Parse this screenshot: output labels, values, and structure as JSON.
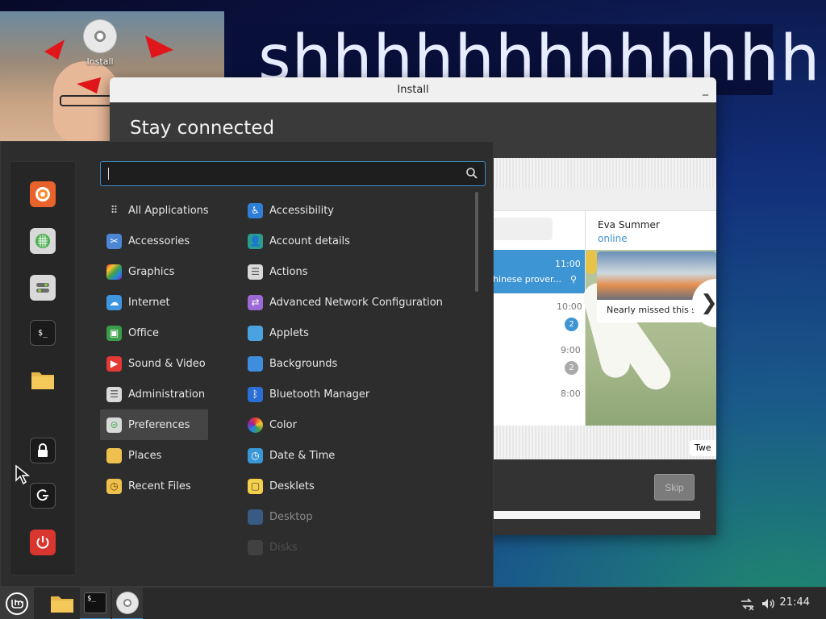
{
  "wallpaper": {
    "text": "shhhhhhhhhhhhhh"
  },
  "desktop_icons": [
    {
      "label": "Install",
      "icon": "cd-icon"
    }
  ],
  "install_window": {
    "title": "Install",
    "minimize_symbol": "_",
    "heading": "Stay connected",
    "skip_label": "Skip",
    "progress_fraction": 1.0,
    "preview": {
      "contact_name": "Eva Summer",
      "contact_status": "online",
      "chats": [
        {
          "time": "11:00",
          "preview": "hinese prover...",
          "selected": true
        },
        {
          "time": "10:00",
          "badge": "2"
        },
        {
          "time": "9:00",
          "badge": "2"
        },
        {
          "time": "8:00"
        }
      ],
      "message_caption": "Nearly missed this s",
      "message_bottom": "Twe",
      "next_symbol": "❯"
    }
  },
  "start_menu": {
    "search_value": "",
    "favorites": [
      {
        "name": "firefox-icon"
      },
      {
        "name": "software-manager-icon"
      },
      {
        "name": "system-settings-icon"
      },
      {
        "name": "terminal-icon"
      },
      {
        "name": "files-icon"
      },
      {
        "name": "lock-screen-icon"
      },
      {
        "name": "logout-icon"
      },
      {
        "name": "shutdown-icon"
      }
    ],
    "categories": [
      {
        "label": "All Applications",
        "icon": "grid-icon"
      },
      {
        "label": "Accessories",
        "icon": "scissors-icon"
      },
      {
        "label": "Graphics",
        "icon": "graphics-icon"
      },
      {
        "label": "Internet",
        "icon": "cloud-icon"
      },
      {
        "label": "Office",
        "icon": "office-icon"
      },
      {
        "label": "Sound & Video",
        "icon": "play-icon"
      },
      {
        "label": "Administration",
        "icon": "administration-icon"
      },
      {
        "label": "Preferences",
        "icon": "preferences-icon",
        "selected": true
      },
      {
        "label": "Places",
        "icon": "folder-icon"
      },
      {
        "label": "Recent Files",
        "icon": "recent-files-icon"
      }
    ],
    "apps": [
      {
        "label": "Accessibility",
        "icon": "accessibility-icon"
      },
      {
        "label": "Account details",
        "icon": "account-icon"
      },
      {
        "label": "Actions",
        "icon": "actions-icon"
      },
      {
        "label": "Advanced Network Configuration",
        "icon": "network-icon"
      },
      {
        "label": "Applets",
        "icon": "applets-icon"
      },
      {
        "label": "Backgrounds",
        "icon": "backgrounds-icon"
      },
      {
        "label": "Bluetooth Manager",
        "icon": "bluetooth-icon"
      },
      {
        "label": "Color",
        "icon": "color-icon"
      },
      {
        "label": "Date & Time",
        "icon": "clock-icon"
      },
      {
        "label": "Desklets",
        "icon": "desklets-icon"
      },
      {
        "label": "Desktop",
        "icon": "desktop-icon"
      },
      {
        "label": "Disks",
        "icon": "disks-icon"
      }
    ]
  },
  "taskbar": {
    "clock": "21:44",
    "tray_icons": [
      "network-disconnected-icon",
      "volume-icon"
    ],
    "launchers": [
      "menu-icon",
      "files-icon",
      "terminal-icon",
      "install-cd-icon"
    ]
  },
  "colors": {
    "accent": "#3d8ec8",
    "menu_bg": "#2d2d2d",
    "panel_bg": "#2a2a2a"
  }
}
